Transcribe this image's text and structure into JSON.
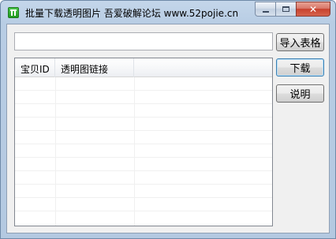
{
  "window": {
    "title": "批量下载透明图片  吾爱破解论坛  www.52pojie.cn",
    "icon": "app-green-icon",
    "caption": {
      "minimize": "minimize",
      "maximize": "maximize",
      "close": "✕"
    }
  },
  "form": {
    "path_value": "",
    "path_placeholder": ""
  },
  "buttons": {
    "import_label": "导入表格",
    "download_label": "下载",
    "help_label": "说明"
  },
  "table": {
    "columns": [
      "宝贝ID",
      "透明图链接",
      ""
    ],
    "rows": []
  }
}
